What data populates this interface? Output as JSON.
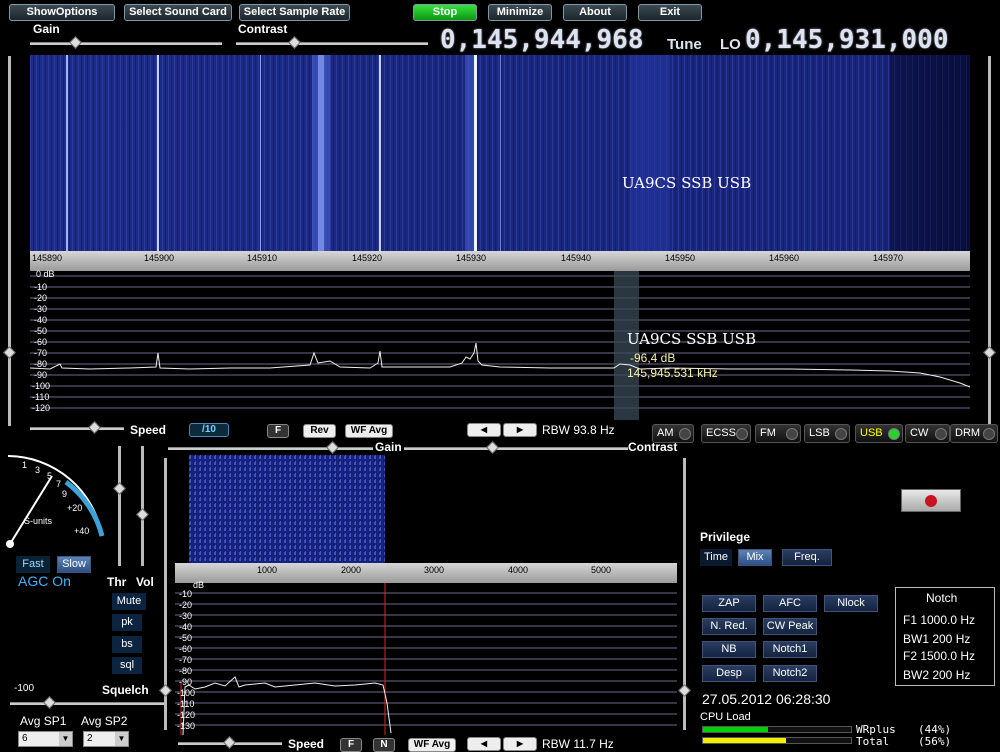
{
  "toolbar": {
    "show_options": "ShowOptions",
    "select_sound_card": "Select Sound Card",
    "select_sample_rate": "Select Sample Rate",
    "stop": "Stop",
    "minimize": "Minimize",
    "about": "About",
    "exit": "Exit"
  },
  "top_sliders": {
    "gain": "Gain",
    "contrast": "Contrast"
  },
  "frequency": {
    "tune_value": "0,145,944,968",
    "tune_label": "Tune",
    "lo_label": "LO",
    "lo_value": "0,145,931,000"
  },
  "main_scale": [
    "145890",
    "145900",
    "145910",
    "145920",
    "145930",
    "145940",
    "145950",
    "145960",
    "145970"
  ],
  "waterfall_label": "UA9CS  SSB  USB",
  "spectrum": {
    "station_label": "UA9CS  SSB  USB",
    "db_readout": "-96,4 dB",
    "freq_readout": "145,945.531 kHz",
    "db_ticks": [
      "0  dB",
      "-10",
      "-20",
      "-30",
      "-40",
      "-50",
      "-60",
      "-70",
      "-80",
      "-90",
      "-100",
      "-110",
      "-120"
    ]
  },
  "main_controls": {
    "speed": "Speed",
    "speed_value": "/10",
    "f_btn": "F",
    "rev": "Rev",
    "wf_avg": "WF Avg",
    "rbw": "RBW 93.8 Hz"
  },
  "modes": [
    {
      "label": "AM",
      "active": false
    },
    {
      "label": "ECSS",
      "active": false
    },
    {
      "label": "FM",
      "active": false
    },
    {
      "label": "LSB",
      "active": false
    },
    {
      "label": "USB",
      "active": true
    },
    {
      "label": "CW",
      "active": false
    },
    {
      "label": "DRM",
      "active": false
    }
  ],
  "smeter": {
    "ticks": [
      "1",
      "3",
      "5",
      "7",
      "9",
      "+20",
      "+40"
    ],
    "units": "S-units"
  },
  "agc": {
    "fast": "Fast",
    "slow": "Slow",
    "status": "AGC On"
  },
  "left_panel": {
    "thr": "Thr",
    "vol": "Vol",
    "mute": "Mute",
    "pk": "pk",
    "bs": "bs",
    "sql": "sql",
    "squelch": "Squelch",
    "squelch_value": "-100",
    "avg_sp1": "Avg SP1",
    "avg_sp2": "Avg SP2",
    "avg_sp1_value": "6",
    "avg_sp2_value": "2"
  },
  "audio": {
    "gain": "Gain",
    "contrast": "Contrast",
    "scale": [
      "1000",
      "2000",
      "3000",
      "4000",
      "5000"
    ],
    "db_ticks": [
      "dB",
      "-10",
      "-20",
      "-30",
      "-40",
      "-50",
      "-60",
      "-70",
      "-80",
      "-90",
      "-100",
      "-110",
      "-120",
      "-130"
    ],
    "speed": "Speed",
    "f_btn": "F",
    "n_btn": "N",
    "wf_avg": "WF Avg",
    "rbw": "RBW 11.7 Hz"
  },
  "privilege": {
    "title": "Privilege",
    "time": "Time",
    "mix": "Mix",
    "freq": "Freq."
  },
  "dsp": {
    "zap": "ZAP",
    "afc": "AFC",
    "nlock": "Nlock",
    "nred": "N. Red.",
    "cw_peak": "CW Peak",
    "nb": "NB",
    "notch1": "Notch1",
    "desp": "Desp",
    "notch2": "Notch2"
  },
  "notch": {
    "title": "Notch",
    "f1": "F1 1000.0 Hz",
    "bw1": "BW1  200 Hz",
    "f2": "F2 1500.0 Hz",
    "bw2": "BW2  200 Hz"
  },
  "datetime": "27.05.2012 06:28:30",
  "cpu": {
    "label": "CPU Load",
    "wrplus_label": "WRplus",
    "wrplus_pct": "(44%)",
    "total_label": "Total",
    "total_pct": "(56%)",
    "wrplus": 0.44,
    "total": 0.56
  },
  "colors": {
    "accent_green": "#2bd12d",
    "waterfall_blue": "#1a2a8a",
    "cpu_green": "#00d000",
    "cpu_yellow": "#f0f000"
  }
}
